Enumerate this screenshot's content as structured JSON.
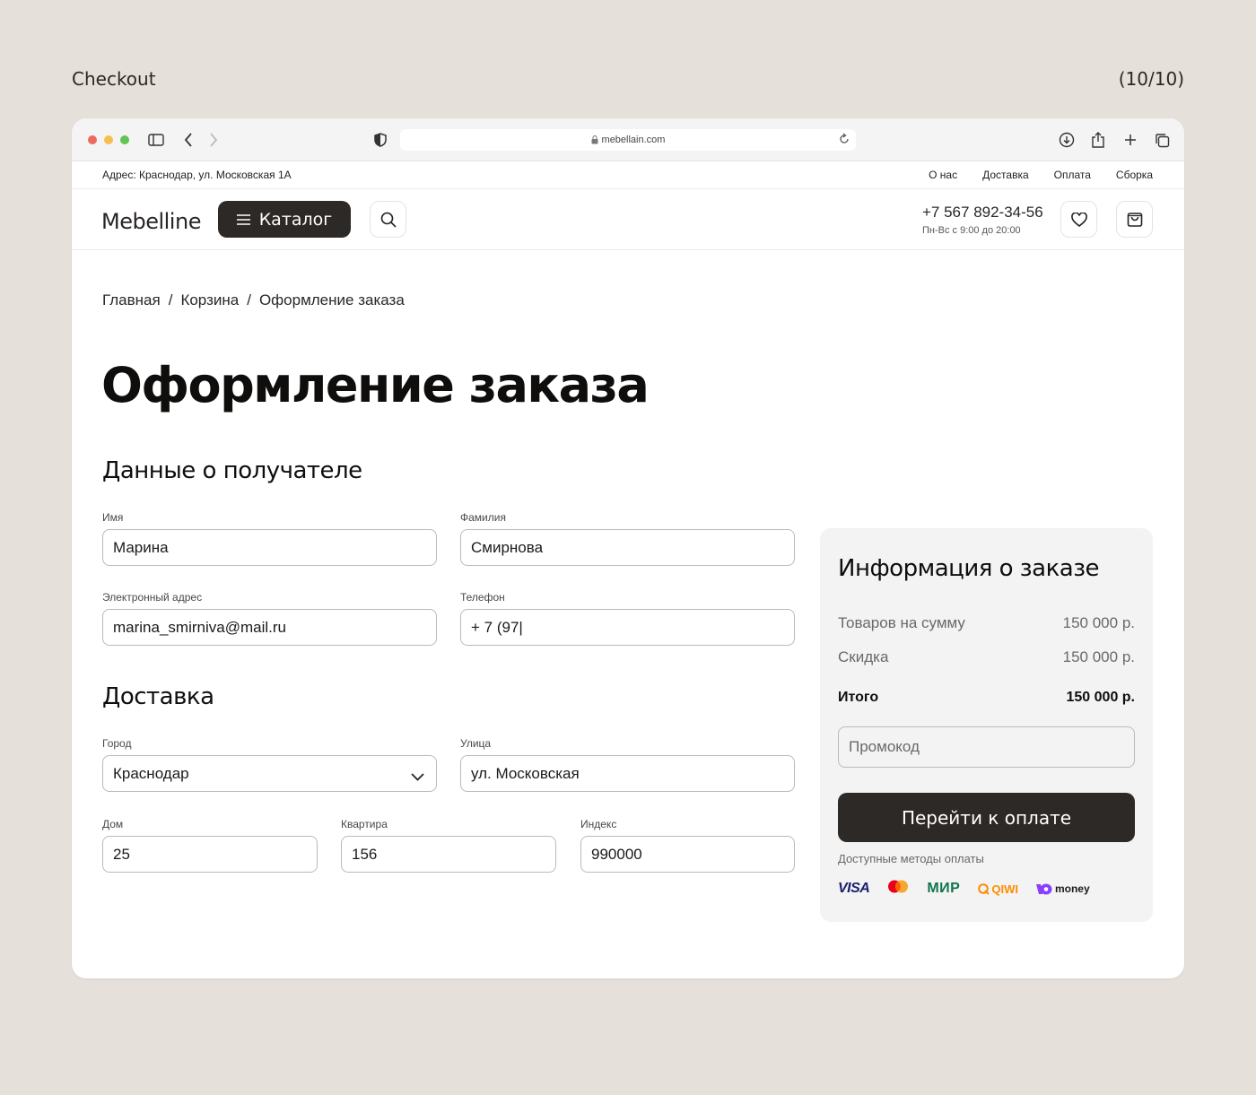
{
  "frame": {
    "title": "Checkout",
    "counter": "(10/10)"
  },
  "browser": {
    "url": "mebellain.com"
  },
  "topbar": {
    "address": "Адрес: Краснодар, ул. Московская 1А",
    "nav": [
      "О нас",
      "Доставка",
      "Оплата",
      "Сборка"
    ]
  },
  "header": {
    "logo": "Mebelline",
    "catalog": "Каталог",
    "phone": "+7 567 892-34-56",
    "hours": "Пн-Вс с 9:00 до 20:00"
  },
  "breadcrumb": [
    "Главная",
    "Корзина",
    "Оформление заказа"
  ],
  "page_title": "Оформление заказа",
  "recipient": {
    "title": "Данные о получателе",
    "first_name": {
      "label": "Имя",
      "value": "Марина"
    },
    "last_name": {
      "label": "Фамилия",
      "value": "Смирнова"
    },
    "email": {
      "label": "Электронный адрес",
      "value": "marina_smirniva@mail.ru"
    },
    "phone": {
      "label": "Телефон",
      "value": "+ 7 (97|"
    }
  },
  "delivery": {
    "title": "Доставка",
    "city": {
      "label": "Город",
      "value": "Краснодар"
    },
    "street": {
      "label": "Улица",
      "value": "ул. Московская"
    },
    "house": {
      "label": "Дом",
      "value": "25"
    },
    "apartment": {
      "label": "Квартира",
      "value": "156"
    },
    "zip": {
      "label": "Индекс",
      "value": "990000"
    }
  },
  "summary": {
    "title": "Информация о заказе",
    "items_label": "Товаров на сумму",
    "items_value": "150 000 р.",
    "discount_label": "Скидка",
    "discount_value": "150 000 р.",
    "total_label": "Итого",
    "total_value": "150 000 р.",
    "promo_placeholder": "Промокод",
    "pay_button": "Перейти к оплате",
    "methods_label": "Доступные методы оплаты",
    "methods": {
      "visa": "VISA",
      "mir": "МИР",
      "qiwi": "QIWI",
      "ymoney": "money"
    }
  },
  "colors": {
    "page_bg": "#e6e0da",
    "button_dark": "#2d2926",
    "summary_bg": "#f3f3f3"
  }
}
